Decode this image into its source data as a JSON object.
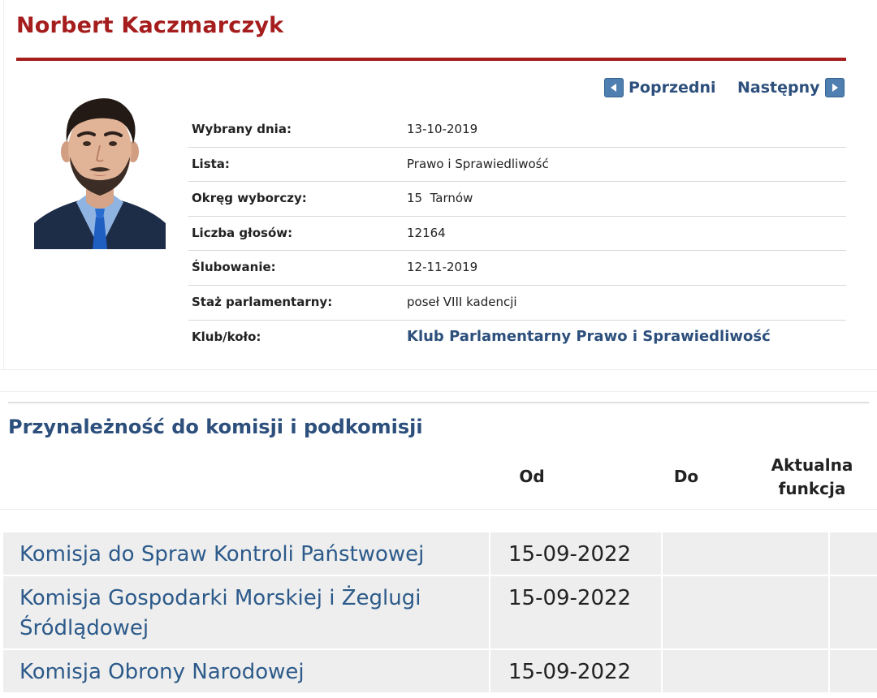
{
  "profile": {
    "name": "Norbert Kaczmarczyk",
    "nav": {
      "prev_label": "Poprzedni",
      "next_label": "Następny"
    },
    "rows": [
      {
        "label": "Wybrany dnia:",
        "value": "13-10-2019"
      },
      {
        "label": "Lista:",
        "value": "Prawo i Sprawiedliwość"
      },
      {
        "label": "Okręg wyborczy:",
        "value": "15  Tarnów"
      },
      {
        "label": "Liczba głosów:",
        "value": "12164"
      },
      {
        "label": "Ślubowanie:",
        "value": "12-11-2019"
      },
      {
        "label": "Staż parlamentarny:",
        "value": "poseł VIII kadencji"
      },
      {
        "label": "Klub/koło:",
        "value": "Klub Parlamentarny Prawo i Sprawiedliwość"
      }
    ]
  },
  "committees": {
    "heading": "Przynależność do komisji i podkomisji",
    "columns": {
      "od": "Od",
      "do": "Do",
      "function_line1": "Aktualna",
      "function_line2": "funkcja"
    },
    "rows": [
      {
        "name_line1": "Komisja do Spraw Kontroli Państwowej",
        "name_line2": "",
        "od": "15-09-2022",
        "do": "",
        "function": ""
      },
      {
        "name_line1": "Komisja Gospodarki Morskiej i Żeglugi",
        "name_line2": "Śródlądowej",
        "od": "15-09-2022",
        "do": "",
        "function": ""
      },
      {
        "name_line1": "Komisja Obrony Narodowej",
        "name_line2": "",
        "od": "15-09-2022",
        "do": "",
        "function": ""
      }
    ]
  },
  "colors": {
    "title_red": "#a51d1d",
    "link_blue": "#2c4f7c",
    "row_grey": "#eeeeee"
  }
}
